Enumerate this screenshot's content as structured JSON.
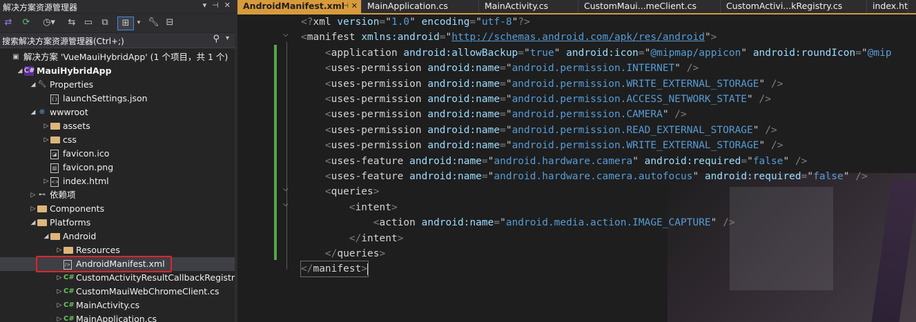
{
  "solution_explorer": {
    "title": "解决方案资源管理器",
    "search_placeholder": "搜索解决方案资源管理器(Ctrl+;)",
    "toolbar_icons": [
      "vs-switch-icon",
      "sync-icon",
      "history-icon",
      "back-forward-icon",
      "collapse-all-icon",
      "show-all-files-icon",
      "properties-wrench-icon",
      "preview-icon"
    ],
    "tree": [
      {
        "label": "解决方案 'VueMauiHybridApp' (1 个项目，共 1 个)",
        "icon": "solution-icon",
        "indent": 0,
        "expander": ""
      },
      {
        "label": "MauiHybridApp",
        "icon": "csharp-project-icon",
        "indent": 1,
        "expander": "expanded"
      },
      {
        "label": "Properties",
        "icon": "wrench-icon",
        "indent": 2,
        "expander": "expanded"
      },
      {
        "label": "launchSettings.json",
        "icon": "json-file-icon",
        "indent": 3,
        "expander": ""
      },
      {
        "label": "wwwroot",
        "icon": "globe-icon",
        "indent": 2,
        "expander": "expanded"
      },
      {
        "label": "assets",
        "icon": "folder-icon",
        "indent": 3,
        "expander": "collapsed"
      },
      {
        "label": "css",
        "icon": "folder-icon",
        "indent": 3,
        "expander": "collapsed"
      },
      {
        "label": "favicon.ico",
        "icon": "ico-file-icon",
        "indent": 3,
        "expander": ""
      },
      {
        "label": "favicon.png",
        "icon": "image-file-icon",
        "indent": 3,
        "expander": ""
      },
      {
        "label": "index.html",
        "icon": "html-file-icon",
        "indent": 3,
        "expander": "collapsed"
      },
      {
        "label": "依赖项",
        "icon": "dependencies-icon",
        "indent": 2,
        "expander": "collapsed"
      },
      {
        "label": "Components",
        "icon": "folder-icon",
        "indent": 2,
        "expander": "collapsed"
      },
      {
        "label": "Platforms",
        "icon": "folder-icon",
        "indent": 2,
        "expander": "expanded"
      },
      {
        "label": "Android",
        "icon": "folder-icon",
        "indent": 3,
        "expander": "expanded"
      },
      {
        "label": "Resources",
        "icon": "folder-icon",
        "indent": 4,
        "expander": "collapsed"
      },
      {
        "label": "AndroidManifest.xml",
        "icon": "xml-file-icon",
        "indent": 4,
        "expander": "",
        "selected": true
      },
      {
        "label": "CustomActivityResultCallbackRegistry.cs",
        "icon": "csharp-file-icon",
        "indent": 4,
        "expander": "collapsed"
      },
      {
        "label": "CustomMauiWebChromeClient.cs",
        "icon": "csharp-file-icon",
        "indent": 4,
        "expander": "collapsed"
      },
      {
        "label": "MainActivity.cs",
        "icon": "csharp-file-icon",
        "indent": 4,
        "expander": "collapsed"
      },
      {
        "label": "MainApplication.cs",
        "icon": "csharp-file-icon",
        "indent": 4,
        "expander": "collapsed"
      }
    ]
  },
  "tabs": [
    {
      "label": "AndroidManifest.xml",
      "active": true
    },
    {
      "label": "MainApplication.cs"
    },
    {
      "label": "MainActivity.cs"
    },
    {
      "label": "CustomMaui...meClient.cs"
    },
    {
      "label": "CustomActivi...kRegistry.cs"
    },
    {
      "label": "index.ht"
    }
  ],
  "code_lines": [
    [
      [
        "b",
        "<?"
      ],
      [
        "tg",
        "xml "
      ],
      [
        "at",
        "version"
      ],
      [
        "b",
        "="
      ],
      [
        "q",
        "\""
      ],
      [
        "av",
        "1.0"
      ],
      [
        "q",
        "\" "
      ],
      [
        "at",
        "encoding"
      ],
      [
        "b",
        "="
      ],
      [
        "q",
        "\""
      ],
      [
        "av",
        "utf-8"
      ],
      [
        "q",
        "\""
      ],
      [
        "b",
        "?>"
      ]
    ],
    [
      [
        "b",
        "<"
      ],
      [
        "tg",
        "manifest "
      ],
      [
        "at",
        "xmlns:android"
      ],
      [
        "b",
        "="
      ],
      [
        "q",
        "\""
      ],
      [
        "lnk",
        "http://schemas.android.com/apk/res/android"
      ],
      [
        "q",
        "\""
      ],
      [
        "b",
        ">"
      ]
    ],
    [
      [
        "b",
        "    <"
      ],
      [
        "tg",
        "application "
      ],
      [
        "at",
        "android:allowBackup"
      ],
      [
        "b",
        "="
      ],
      [
        "q",
        "\""
      ],
      [
        "av",
        "true"
      ],
      [
        "q",
        "\" "
      ],
      [
        "at",
        "android:icon"
      ],
      [
        "b",
        "="
      ],
      [
        "q",
        "\""
      ],
      [
        "av",
        "@mipmap/appicon"
      ],
      [
        "q",
        "\" "
      ],
      [
        "at",
        "android:roundIcon"
      ],
      [
        "b",
        "="
      ],
      [
        "q",
        "\""
      ],
      [
        "av",
        "@mip"
      ]
    ],
    [
      [
        "b",
        "    <"
      ],
      [
        "tg",
        "uses-permission "
      ],
      [
        "at",
        "android:name"
      ],
      [
        "b",
        "="
      ],
      [
        "q",
        "\""
      ],
      [
        "av",
        "android.permission.INTERNET"
      ],
      [
        "q",
        "\" "
      ],
      [
        "b",
        "/>"
      ]
    ],
    [
      [
        "b",
        "    <"
      ],
      [
        "tg",
        "uses-permission "
      ],
      [
        "at",
        "android:name"
      ],
      [
        "b",
        "="
      ],
      [
        "q",
        "\""
      ],
      [
        "av",
        "android.permission.WRITE_EXTERNAL_STORAGE"
      ],
      [
        "q",
        "\" "
      ],
      [
        "b",
        "/>"
      ]
    ],
    [
      [
        "b",
        "    <"
      ],
      [
        "tg",
        "uses-permission "
      ],
      [
        "at",
        "android:name"
      ],
      [
        "b",
        "="
      ],
      [
        "q",
        "\""
      ],
      [
        "av",
        "android.permission.ACCESS_NETWORK_STATE"
      ],
      [
        "q",
        "\" "
      ],
      [
        "b",
        "/>"
      ]
    ],
    [
      [
        "b",
        "    <"
      ],
      [
        "tg",
        "uses-permission "
      ],
      [
        "at",
        "android:name"
      ],
      [
        "b",
        "="
      ],
      [
        "q",
        "\""
      ],
      [
        "av",
        "android.permission.CAMERA"
      ],
      [
        "q",
        "\" "
      ],
      [
        "b",
        "/>"
      ]
    ],
    [
      [
        "b",
        "    <"
      ],
      [
        "tg",
        "uses-permission "
      ],
      [
        "at",
        "android:name"
      ],
      [
        "b",
        "="
      ],
      [
        "q",
        "\""
      ],
      [
        "av",
        "android.permission.READ_EXTERNAL_STORAGE"
      ],
      [
        "q",
        "\" "
      ],
      [
        "b",
        "/>"
      ]
    ],
    [
      [
        "b",
        "    <"
      ],
      [
        "tg",
        "uses-permission "
      ],
      [
        "at",
        "android:name"
      ],
      [
        "b",
        "="
      ],
      [
        "q",
        "\""
      ],
      [
        "av",
        "android.permission.WRITE_EXTERNAL_STORAGE"
      ],
      [
        "q",
        "\" "
      ],
      [
        "b",
        "/>"
      ]
    ],
    [
      [
        "b",
        "    <"
      ],
      [
        "tg",
        "uses-feature "
      ],
      [
        "at",
        "android:name"
      ],
      [
        "b",
        "="
      ],
      [
        "q",
        "\""
      ],
      [
        "av",
        "android.hardware.camera"
      ],
      [
        "q",
        "\" "
      ],
      [
        "at",
        "android:required"
      ],
      [
        "b",
        "="
      ],
      [
        "q",
        "\""
      ],
      [
        "av",
        "false"
      ],
      [
        "q",
        "\" "
      ],
      [
        "b",
        "/>"
      ]
    ],
    [
      [
        "b",
        "    <"
      ],
      [
        "tg",
        "uses-feature "
      ],
      [
        "at",
        "android:name"
      ],
      [
        "b",
        "="
      ],
      [
        "q",
        "\""
      ],
      [
        "av",
        "android.hardware.camera.autofocus"
      ],
      [
        "q",
        "\" "
      ],
      [
        "at",
        "android:required"
      ],
      [
        "b",
        "="
      ],
      [
        "q",
        "\""
      ],
      [
        "av",
        "false"
      ],
      [
        "q",
        "\" "
      ],
      [
        "b",
        "/>"
      ]
    ],
    [
      [
        "b",
        "    <"
      ],
      [
        "tg",
        "queries"
      ],
      [
        "b",
        ">"
      ]
    ],
    [
      [
        "b",
        "        <"
      ],
      [
        "tg",
        "intent"
      ],
      [
        "b",
        ">"
      ]
    ],
    [
      [
        "b",
        "            <"
      ],
      [
        "tg",
        "action "
      ],
      [
        "at",
        "android:name"
      ],
      [
        "b",
        "="
      ],
      [
        "q",
        "\""
      ],
      [
        "av",
        "android.media.action.IMAGE_CAPTURE"
      ],
      [
        "q",
        "\" "
      ],
      [
        "b",
        "/>"
      ]
    ],
    [
      [
        "b",
        "        </"
      ],
      [
        "tg",
        "intent"
      ],
      [
        "b",
        ">"
      ]
    ],
    [
      [
        "b",
        "    </"
      ],
      [
        "tg",
        "queries"
      ],
      [
        "b",
        ">"
      ]
    ],
    [
      [
        "b",
        "</"
      ],
      [
        "tg",
        "manifest"
      ],
      [
        "b",
        ">"
      ]
    ]
  ],
  "colors": {
    "accent_tab": "#d89b3c",
    "xml_attribute": "#9cdcfe",
    "xml_value": "#569cd6",
    "change_bar": "#57a64a",
    "highlight_box": "#e0242a"
  }
}
